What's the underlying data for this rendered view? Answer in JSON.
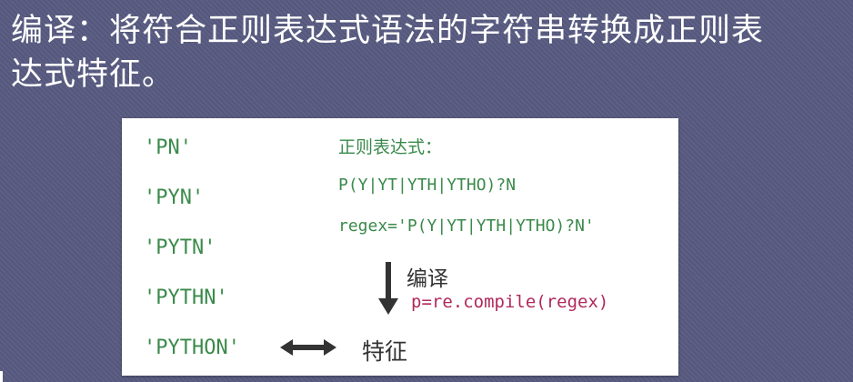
{
  "title": {
    "line1": "编译：将符合正则表达式语法的字符串转换成正则表",
    "line2": "达式特征。"
  },
  "patterns": [
    "'PN'",
    "'PYN'",
    "'PYTN'",
    "'PYTHN'",
    "'PYTHON'"
  ],
  "regex": {
    "label": "正则表达式：",
    "expression": "P(Y|YT|YTH|YTHO)?N",
    "assignment": "regex='P(Y|YT|YTH|YTHO)?N'"
  },
  "compile": {
    "word": "编译",
    "code": "p=re.compile(regex)"
  },
  "feature": {
    "word": "特征"
  },
  "icons": {
    "down_arrow": "arrow-down-icon",
    "double_arrow": "double-arrow-icon"
  },
  "colors": {
    "background": "#585b80",
    "panel": "#ffffff",
    "green_text": "#3a8a4a",
    "code_red": "#b0285a",
    "dark_text": "#333333"
  }
}
